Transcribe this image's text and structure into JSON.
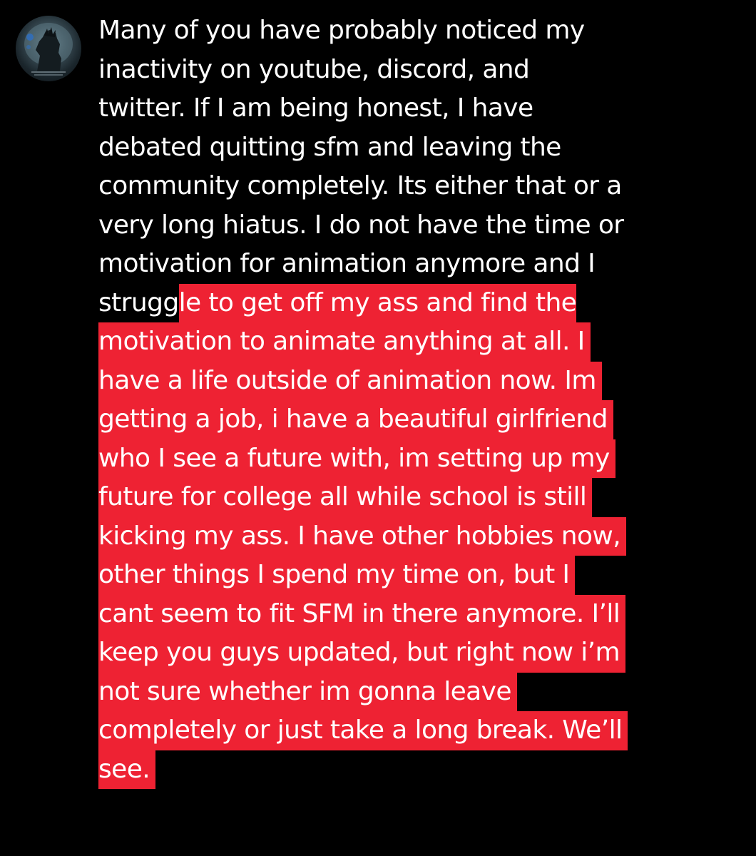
{
  "post": {
    "avatar_icon": "kaiju-avatar-icon",
    "highlight_color": "#ee2233",
    "lines": [
      {
        "plain": "Many of you have probably noticed my",
        "hl": ""
      },
      {
        "plain": "inactivity on youtube, discord, and",
        "hl": ""
      },
      {
        "plain": "twitter. If I am being honest, I have",
        "hl": ""
      },
      {
        "plain": "debated quitting sfm and leaving the",
        "hl": ""
      },
      {
        "plain": "community completely. Its either that or a",
        "hl": ""
      },
      {
        "plain": "very long hiatus. I do not have the time or",
        "hl": ""
      },
      {
        "plain": "motivation for animation anymore and I",
        "hl": ""
      },
      {
        "plain": "strugg",
        "hl": "le to get off my ass and find the"
      },
      {
        "plain": "",
        "hl": "motivation to animate anything at all. I"
      },
      {
        "plain": "",
        "hl": "have a life outside of animation now. Im"
      },
      {
        "plain": "",
        "hl": "getting a job, i have a beautiful girlfriend"
      },
      {
        "plain": "",
        "hl": "who I see a future with, im setting up my"
      },
      {
        "plain": "",
        "hl": "future for college all while school is still"
      },
      {
        "plain": "",
        "hl": "kicking my ass. I have other hobbies now,"
      },
      {
        "plain": "",
        "hl": "other things I spend my time on, but I"
      },
      {
        "plain": "",
        "hl": "cant seem to fit SFM in there anymore. I’ll"
      },
      {
        "plain": "",
        "hl": "keep you guys updated, but right now i’m"
      },
      {
        "plain": "",
        "hl": "not sure whether im gonna leave"
      },
      {
        "plain": "",
        "hl": "completely or just take a long break. We’ll"
      },
      {
        "plain": "",
        "hl": "see."
      }
    ]
  }
}
